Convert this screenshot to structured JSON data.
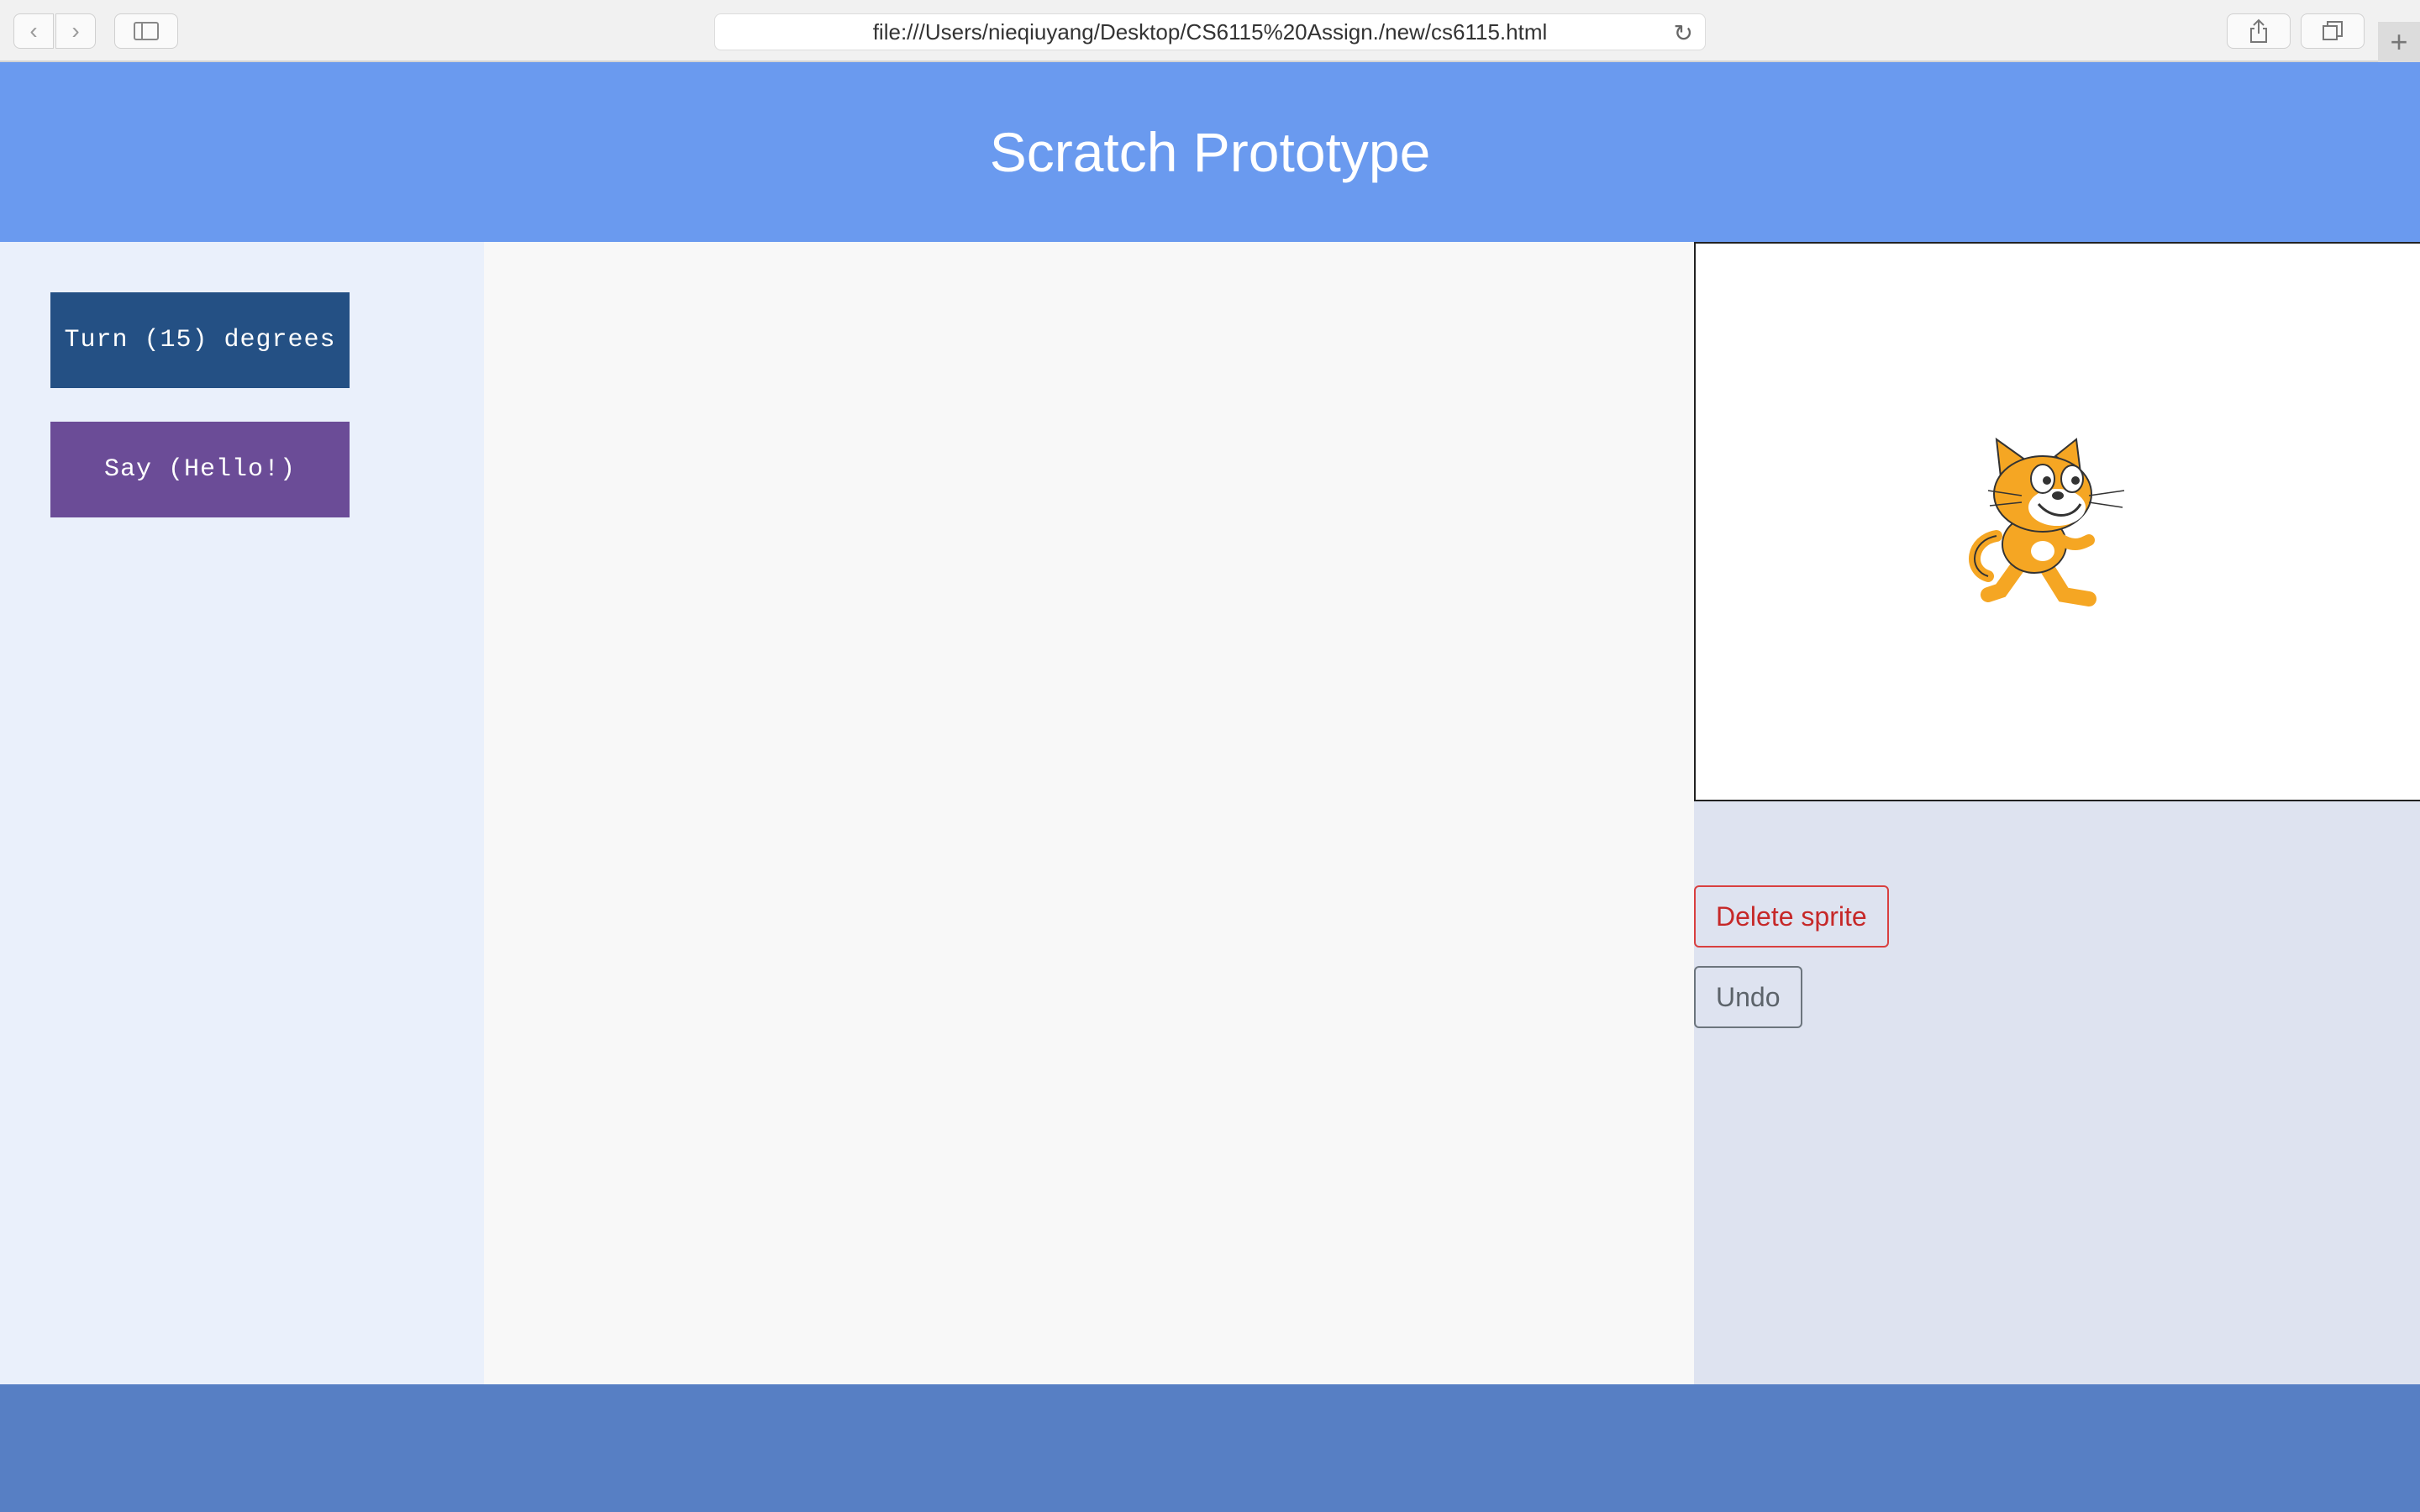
{
  "browser": {
    "url": "file:///Users/nieqiuyang/Desktop/CS6115%20Assign./new/cs6115.html",
    "back_icon": "‹",
    "forward_icon": "›",
    "new_tab_icon": "+"
  },
  "header": {
    "title": "Scratch Prototype"
  },
  "palette": {
    "blocks": [
      {
        "label": "Turn (15) degrees",
        "color": "#245084"
      },
      {
        "label": "Say (Hello!)",
        "color": "#6b4c97"
      }
    ]
  },
  "controls": {
    "delete_label": "Delete sprite",
    "undo_label": "Undo"
  },
  "colors": {
    "header": "#6a9aef",
    "footer": "#577fc4",
    "palette_bg": "#eaf0fb",
    "workspace_bg": "#f8f8f8",
    "right_panel_bg": "#dee3f0",
    "danger": "#d94040"
  }
}
